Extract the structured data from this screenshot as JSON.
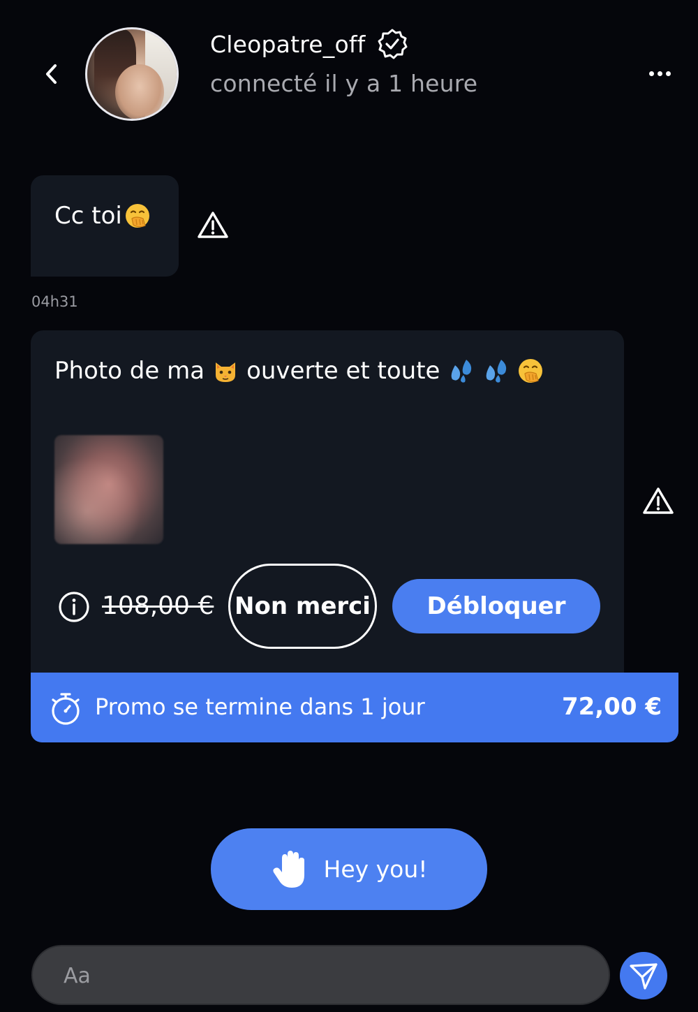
{
  "header": {
    "username": "Cleopatre_off",
    "status": "connecté il y a 1 heure",
    "verified": true
  },
  "messages": [
    {
      "text": "Cc toi",
      "emoji": [
        "face-with-hand-over-mouth"
      ],
      "time": "04h31"
    },
    {
      "text_parts": [
        "Photo de ma",
        "ouverte et toute"
      ],
      "emoji": [
        "cat-face",
        "sweat-droplets",
        "sweat-droplets",
        "face-with-hand-over-mouth"
      ],
      "old_price": "108,00 €",
      "decline_label": "Non merci",
      "unlock_label": "Débloquer",
      "promo": {
        "text": "Promo se termine dans 1 jour",
        "price": "72,00 €"
      }
    }
  ],
  "quick_reply": {
    "label": "Hey you!",
    "icon": "raised-hand-icon"
  },
  "composer": {
    "placeholder": "Aa"
  },
  "colors": {
    "background": "#05060b",
    "bubble": "#131821",
    "accent": "#4479f0",
    "muted_text": "#a9aab0"
  }
}
